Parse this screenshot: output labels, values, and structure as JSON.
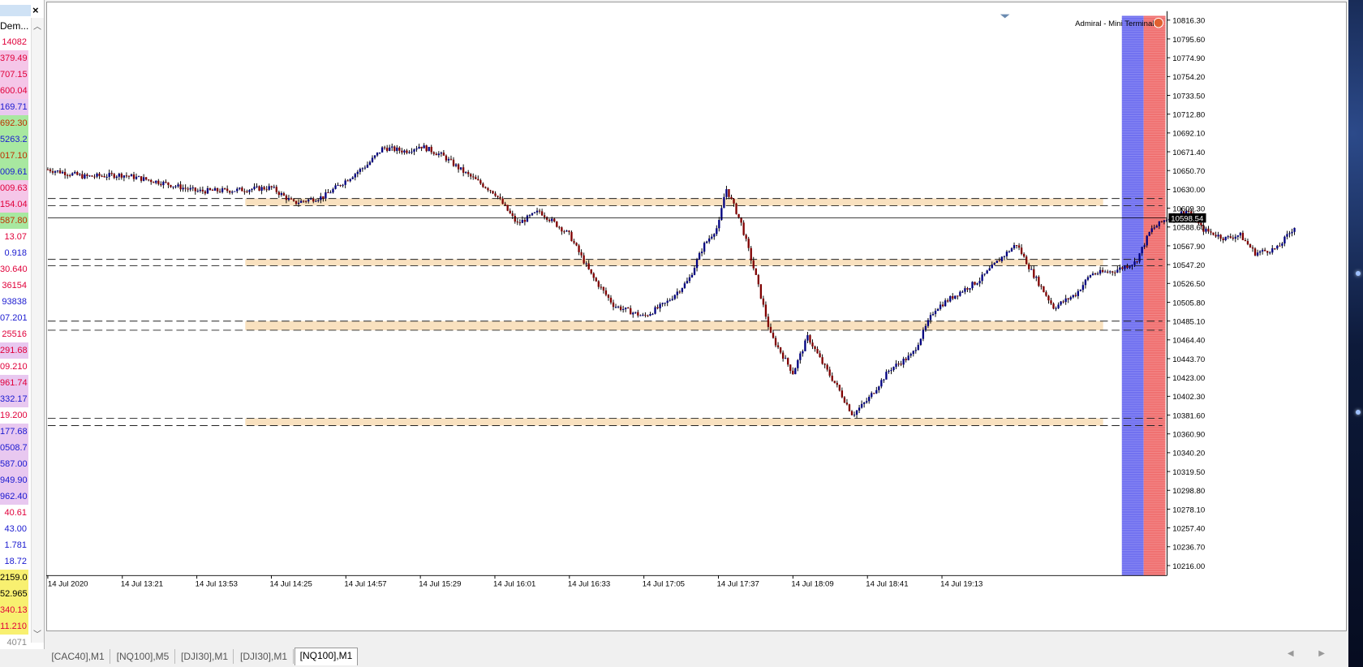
{
  "market_watch": {
    "header_label": "Dem...",
    "values": [
      {
        "text": "14082",
        "color": "#e0003a",
        "bg": "#ffffff"
      },
      {
        "text": "379.49",
        "color": "#e0003a",
        "bg": "#f5c6e8"
      },
      {
        "text": "707.15",
        "color": "#e0003a",
        "bg": "#f5c6e8"
      },
      {
        "text": "600.04",
        "color": "#e0003a",
        "bg": "#f5c6e8"
      },
      {
        "text": "169.71",
        "color": "#1a1ad0",
        "bg": "#e8c8f0"
      },
      {
        "text": "692.30",
        "color": "#c03000",
        "bg": "#a8e8a0"
      },
      {
        "text": "5263.2",
        "color": "#1a1ad0",
        "bg": "#a8e8a0"
      },
      {
        "text": "017.10",
        "color": "#c03000",
        "bg": "#a8e8a0"
      },
      {
        "text": "009.61",
        "color": "#1a1ad0",
        "bg": "#a8e8a0"
      },
      {
        "text": "009.63",
        "color": "#e0003a",
        "bg": "#f5c6e8"
      },
      {
        "text": "154.04",
        "color": "#e0003a",
        "bg": "#f5c6e8"
      },
      {
        "text": "587.80",
        "color": "#c03000",
        "bg": "#a8e8a0"
      },
      {
        "text": "13.07",
        "color": "#e0003a",
        "bg": "#ffffff"
      },
      {
        "text": "0.918",
        "color": "#1a1ad0",
        "bg": "#ffffff"
      },
      {
        "text": "30.640",
        "color": "#e0003a",
        "bg": "#ffffff"
      },
      {
        "text": "36154",
        "color": "#e0003a",
        "bg": "#ffffff"
      },
      {
        "text": "93838",
        "color": "#1a1ad0",
        "bg": "#ffffff"
      },
      {
        "text": "07.201",
        "color": "#1a1ad0",
        "bg": "#ffffff"
      },
      {
        "text": "25516",
        "color": "#e0003a",
        "bg": "#ffffff"
      },
      {
        "text": "291.68",
        "color": "#e0003a",
        "bg": "#e8c8f0"
      },
      {
        "text": "09.210",
        "color": "#e0003a",
        "bg": "#ffffff"
      },
      {
        "text": "961.74",
        "color": "#e0003a",
        "bg": "#e8c8f0"
      },
      {
        "text": "332.17",
        "color": "#1a1ad0",
        "bg": "#e8c8f0"
      },
      {
        "text": "19.200",
        "color": "#e0003a",
        "bg": "#ffffff"
      },
      {
        "text": "177.68",
        "color": "#1a1ad0",
        "bg": "#e8c8f0"
      },
      {
        "text": "0508.7",
        "color": "#1a1ad0",
        "bg": "#e8c8f0"
      },
      {
        "text": "587.00",
        "color": "#1a1ad0",
        "bg": "#e8c8f0"
      },
      {
        "text": "949.90",
        "color": "#1a1ad0",
        "bg": "#e8c8f0"
      },
      {
        "text": "962.40",
        "color": "#1a1ad0",
        "bg": "#e8c8f0"
      },
      {
        "text": "40.61",
        "color": "#e0003a",
        "bg": "#ffffff"
      },
      {
        "text": "43.00",
        "color": "#1a1ad0",
        "bg": "#ffffff"
      },
      {
        "text": "1.781",
        "color": "#1a1ad0",
        "bg": "#ffffff"
      },
      {
        "text": "18.72",
        "color": "#1a1ad0",
        "bg": "#ffffff"
      },
      {
        "text": "2159.0",
        "color": "#000000",
        "bg": "#f8f070"
      },
      {
        "text": "52.965",
        "color": "#000000",
        "bg": "#f8f070"
      },
      {
        "text": "340.13",
        "color": "#e0003a",
        "bg": "#f8f070"
      },
      {
        "text": "11.210",
        "color": "#e0003a",
        "bg": "#f8f070"
      },
      {
        "text": "4071",
        "color": "#888888",
        "bg": "#ffffff"
      }
    ]
  },
  "chart": {
    "widget_label": "Admiral - Mini Terminal",
    "current_price_label": "10598.54",
    "y_ticks": [
      "10816.30",
      "10795.60",
      "10774.90",
      "10754.20",
      "10733.50",
      "10712.80",
      "10692.10",
      "10671.40",
      "10650.70",
      "10630.00",
      "10609.30",
      "10588.60",
      "10567.90",
      "10547.20",
      "10526.50",
      "10505.80",
      "10485.10",
      "10464.40",
      "10443.70",
      "10423.00",
      "10402.30",
      "10381.60",
      "10360.90",
      "10340.20",
      "10319.50",
      "10298.80",
      "10278.10",
      "10257.40",
      "10236.70",
      "10216.00"
    ],
    "x_ticks": [
      "14 Jul 2020",
      "14 Jul 13:21",
      "14 Jul 13:53",
      "14 Jul 14:25",
      "14 Jul 14:57",
      "14 Jul 15:29",
      "14 Jul 16:01",
      "14 Jul 16:33",
      "14 Jul 17:05",
      "14 Jul 17:37",
      "14 Jul 18:09",
      "14 Jul 18:41",
      "14 Jul 19:13"
    ],
    "colors": {
      "bull": "#000080",
      "bear": "#800000",
      "zone": "#f8dcb4",
      "buy_panel": "#7070f0",
      "sell_panel": "#f07070"
    }
  },
  "chart_data": {
    "type": "candlestick",
    "ylim": [
      10205,
      10821
    ],
    "current_price": 10598.54,
    "x": [
      "14 Jul 2020",
      "14 Jul 13:21",
      "14 Jul 13:53",
      "14 Jul 14:25",
      "14 Jul 14:57",
      "14 Jul 15:29",
      "14 Jul 16:01",
      "14 Jul 16:33",
      "14 Jul 17:05",
      "14 Jul 17:37",
      "14 Jul 18:09",
      "14 Jul 18:41",
      "14 Jul 19:13"
    ],
    "price_path": [
      [
        0,
        10652
      ],
      [
        0.5,
        10644
      ],
      [
        1,
        10646
      ],
      [
        1.5,
        10638
      ],
      [
        2,
        10628
      ],
      [
        2.5,
        10629
      ],
      [
        3,
        10632
      ],
      [
        3.3,
        10615
      ],
      [
        3.7,
        10622
      ],
      [
        4,
        10640
      ],
      [
        4.3,
        10658
      ],
      [
        4.5,
        10676
      ],
      [
        4.8,
        10672
      ],
      [
        5,
        10678
      ],
      [
        5.3,
        10667
      ],
      [
        5.6,
        10648
      ],
      [
        6,
        10626
      ],
      [
        6.3,
        10592
      ],
      [
        6.6,
        10606
      ],
      [
        7,
        10580
      ],
      [
        7.3,
        10535
      ],
      [
        7.6,
        10502
      ],
      [
        8,
        10490
      ],
      [
        8.3,
        10505
      ],
      [
        8.6,
        10530
      ],
      [
        8.8,
        10568
      ],
      [
        9,
        10590
      ],
      [
        9.1,
        10632
      ],
      [
        9.3,
        10594
      ],
      [
        9.5,
        10535
      ],
      [
        9.7,
        10470
      ],
      [
        10,
        10428
      ],
      [
        10.2,
        10468
      ],
      [
        10.4,
        10438
      ],
      [
        10.6,
        10412
      ],
      [
        10.8,
        10382
      ],
      [
        11,
        10398
      ],
      [
        11.3,
        10432
      ],
      [
        11.6,
        10448
      ],
      [
        11.9,
        10498
      ],
      [
        12.2,
        10515
      ],
      [
        12.5,
        10530
      ],
      [
        12.8,
        10555
      ],
      [
        13,
        10570
      ],
      [
        13.2,
        10540
      ],
      [
        13.5,
        10500
      ],
      [
        13.8,
        10515
      ],
      [
        14,
        10537
      ],
      [
        14.3,
        10540
      ],
      [
        14.6,
        10550
      ],
      [
        14.8,
        10585
      ],
      [
        15,
        10597
      ],
      [
        15.3,
        10607
      ],
      [
        15.5,
        10586
      ],
      [
        15.8,
        10576
      ],
      [
        16,
        10580
      ],
      [
        16.2,
        10560
      ],
      [
        16.5,
        10565
      ],
      [
        16.8,
        10596
      ],
      [
        17,
        10616
      ],
      [
        17.3,
        10600
      ],
      [
        17.5,
        10590
      ],
      [
        17.7,
        10599
      ]
    ],
    "zones": [
      [
        10612,
        10620
      ],
      [
        10546,
        10553
      ],
      [
        10475,
        10485
      ],
      [
        10370,
        10378
      ]
    ]
  },
  "tabs": [
    {
      "label": "[CAC40],M1",
      "active": false
    },
    {
      "label": "[NQ100],M5",
      "active": false
    },
    {
      "label": "[DJI30],M1",
      "active": false
    },
    {
      "label": "[DJI30],M1",
      "active": false
    },
    {
      "label": "[NQ100],M1",
      "active": true
    }
  ],
  "icons": {
    "close": "close-icon",
    "scroll_up": "chevron-up-icon",
    "scroll_down": "chevron-down-icon",
    "scroll_left": "arrow-left-icon",
    "scroll_right": "arrow-right-icon"
  }
}
